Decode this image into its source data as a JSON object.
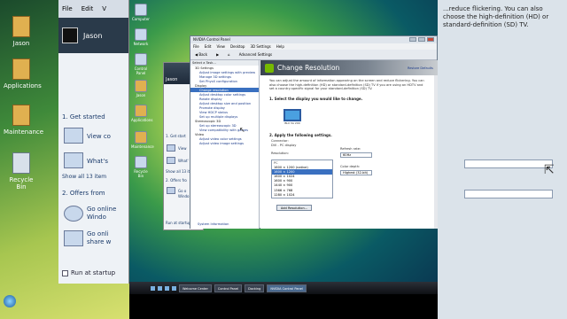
{
  "colors": {
    "nvidia_green": "#76b900",
    "selection_blue": "#3a70c0",
    "taskbar": "#1e2228"
  },
  "left_desktop": {
    "icons": [
      {
        "label": "Jason",
        "icon": "folder-icon"
      },
      {
        "label": "Applications",
        "icon": "folder-icon"
      },
      {
        "label": "Maintenance",
        "icon": "folder-icon"
      },
      {
        "label": "Recycle Bin",
        "icon": "recycle-bin-icon"
      }
    ]
  },
  "welcome_center": {
    "menu": [
      "File",
      "Edit",
      "V"
    ],
    "user_name": "Jason",
    "section1": "1. Get started",
    "view_link": "View co",
    "whats_link": "What's",
    "show_all": "Show all 13 item",
    "section2": "2. Offers from",
    "go_online": "Go online",
    "windows_link": "Windo",
    "go_online2": "Go onli",
    "share_link": "share w",
    "startup_label": "Run at startup"
  },
  "right_panel": {
    "text": "...reduce flickering. You can also choose the high-definition (HD) or standard-definition (SD) TV."
  },
  "control_panel_behind": {
    "user": "Jason",
    "section1": "1. Get start",
    "view": "View",
    "whats": "What'",
    "show_all": "Show all 13 ite",
    "section2": "2. Offers fro",
    "go_online": "Go o",
    "windows": "Windo",
    "startup_label": "Run at startup"
  },
  "desktop_icons": [
    {
      "label": "Computer",
      "icon": "computer-icon"
    },
    {
      "label": "Network",
      "icon": "network-icon"
    },
    {
      "label": "Control Panel",
      "icon": "control-panel-icon"
    },
    {
      "label": "Jason",
      "icon": "user-folder-icon"
    },
    {
      "label": "Applications",
      "icon": "folder-icon"
    },
    {
      "label": "Maintenance",
      "icon": "folder-icon"
    },
    {
      "label": "Recycle Bin",
      "icon": "recycle-bin-icon"
    }
  ],
  "nvidia": {
    "title": "NVIDIA Control Panel",
    "menu": [
      "File",
      "Edit",
      "View",
      "Desktop",
      "3D Settings",
      "Help"
    ],
    "toolbar": {
      "back": "Back",
      "advanced": "Advanced Settings"
    },
    "tree_header": "Select a Task...",
    "tree": [
      {
        "type": "cat",
        "label": "3D Settings"
      },
      {
        "type": "item",
        "label": "Adjust image settings with preview"
      },
      {
        "type": "item",
        "label": "Manage 3D settings"
      },
      {
        "type": "item",
        "label": "Set PhysX configuration"
      },
      {
        "type": "cat",
        "label": "Display"
      },
      {
        "type": "item",
        "label": "Change resolution",
        "selected": true
      },
      {
        "type": "item",
        "label": "Adjust desktop color settings"
      },
      {
        "type": "item",
        "label": "Rotate display"
      },
      {
        "type": "item",
        "label": "Adjust desktop size and position"
      },
      {
        "type": "item",
        "label": "Promote display"
      },
      {
        "type": "item",
        "label": "View HDCP status"
      },
      {
        "type": "item",
        "label": "Set up multiple displays"
      },
      {
        "type": "cat",
        "label": "Stereoscopic 3D"
      },
      {
        "type": "item",
        "label": "Set up stereoscopic 3D"
      },
      {
        "type": "item",
        "label": "View compatibility with games"
      },
      {
        "type": "cat",
        "label": "Video"
      },
      {
        "type": "item",
        "label": "Adjust video color settings"
      },
      {
        "type": "item",
        "label": "Adjust video image settings"
      }
    ],
    "system_info": "System Information",
    "page_title": "Change Resolution",
    "restore_defaults": "Restore Defaults",
    "description": "You can adjust the amount of information appearing on the screen and reduce flickering. You can also choose the high-definition (HD) or standard-definition (SD) TV if you are using an HDTV and set a country-specific signal for your standard-definition (SD) TV.",
    "step1": "1. Select the display you would like to change.",
    "monitor_label": "BLU VA 200",
    "step2": "2. Apply the following settings.",
    "connector_label": "Connector:",
    "connector_value": "DVI - PC display",
    "resolution_label": "Resolution:",
    "resolutions": [
      "PC",
      "1600 × 1200 (native)",
      "1600 × 1200",
      "1600 × 1024",
      "1600 × 900",
      "1440 × 900",
      "1366 × 768",
      "1280 × 1024"
    ],
    "resolution_selected": 2,
    "refresh_label": "Refresh rate:",
    "refresh_value": "60Hz",
    "depth_label": "Color depth:",
    "depth_value": "Highest (32-bit)",
    "add_resolution": "Add Resolution..."
  },
  "taskbar": {
    "tasks": [
      {
        "label": "Welcome Center",
        "active": false
      },
      {
        "label": "Control Panel",
        "active": false
      },
      {
        "label": "Docking",
        "active": false
      },
      {
        "label": "NVIDIA Control Panel",
        "active": true
      }
    ]
  }
}
